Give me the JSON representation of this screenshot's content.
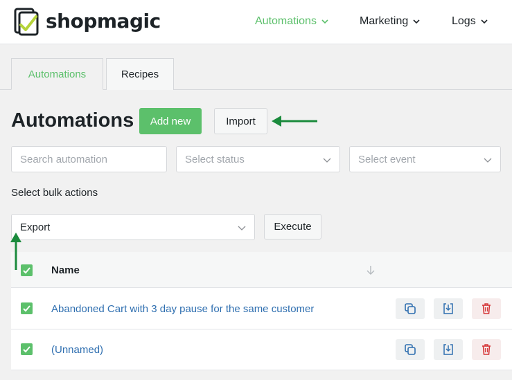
{
  "brand": {
    "name": "shopmagic"
  },
  "nav": [
    {
      "label": "Automations",
      "active": true
    },
    {
      "label": "Marketing",
      "active": false
    },
    {
      "label": "Logs",
      "active": false
    }
  ],
  "tabs": [
    {
      "label": "Automations",
      "active": true
    },
    {
      "label": "Recipes",
      "active": false
    }
  ],
  "page": {
    "title": "Automations",
    "add_new_label": "Add new",
    "import_label": "Import"
  },
  "filters": {
    "search_placeholder": "Search automation",
    "status_placeholder": "Select status",
    "event_placeholder": "Select event"
  },
  "bulk": {
    "label": "Select bulk actions",
    "selected_action": "Export",
    "execute_label": "Execute"
  },
  "table": {
    "header_name": "Name",
    "rows": [
      {
        "name": "Abandoned Cart with 3 day pause for the same customer",
        "checked": true
      },
      {
        "name": "(Unnamed)",
        "checked": true
      }
    ]
  },
  "colors": {
    "accent": "#5cc06b",
    "link": "#2f6fb0",
    "danger": "#d63638",
    "annotation_arrow": "#1a8a3c"
  },
  "icons": {
    "duplicate": "duplicate-icon",
    "export": "download-icon",
    "delete": "trash-icon",
    "sort": "sort-arrow-icon"
  }
}
